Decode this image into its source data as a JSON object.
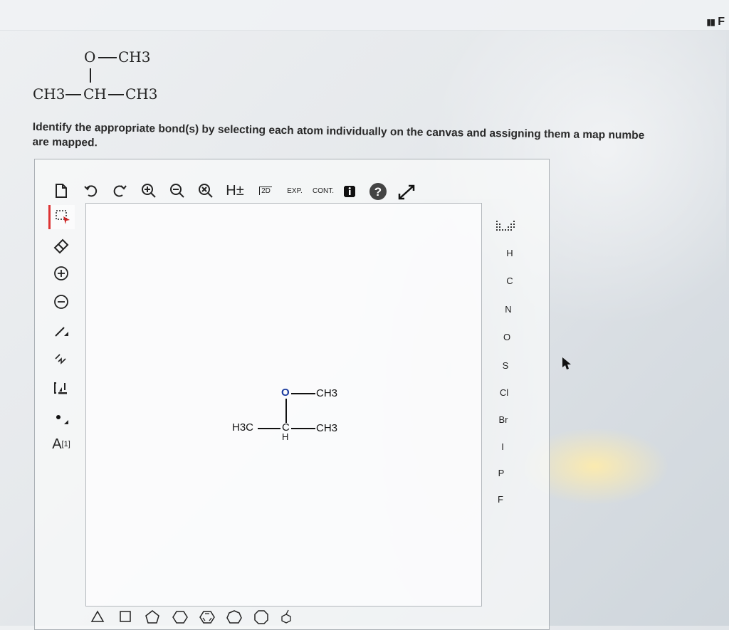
{
  "header": {
    "corner_label": "F"
  },
  "structure": {
    "o_label": "O",
    "ch3_top": "CH3",
    "ch3_left": "CH3",
    "ch_center": "CH",
    "ch3_right": "CH3"
  },
  "question": {
    "line1": "Identify the appropriate bond(s) by selecting each atom individually on the canvas and assigning them a map numbe",
    "line2": "are mapped."
  },
  "toolbar": {
    "h_toggle": "H±",
    "label_2d": "2D",
    "exp_label": "EXP.",
    "cont_label": "CONT."
  },
  "left_tools": {
    "charge_label": "A",
    "charge_superscript": "[1]"
  },
  "elements": [
    "H",
    "C",
    "N",
    "O",
    "S",
    "Cl",
    "Br",
    "I",
    "P",
    "F"
  ],
  "molecule": {
    "o_atom": "O",
    "ch3_top": "CH3",
    "h3c_left": "H3C",
    "c_atom": "C",
    "h_atom": "H",
    "ch3_right": "CH3"
  }
}
